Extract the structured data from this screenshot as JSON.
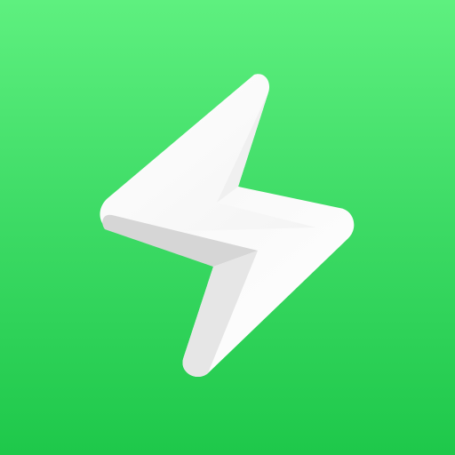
{
  "app_icon": {
    "icon": "lightning-bolt-icon",
    "colors": {
      "background_top": "#5ef07f",
      "background_bottom": "#1ec84a",
      "bolt_light": "#ffffff",
      "bolt_mid": "#f2f2f2",
      "bolt_shade": "#d9d9d9",
      "bolt_fold_shadow": "#c9c9c9"
    }
  }
}
